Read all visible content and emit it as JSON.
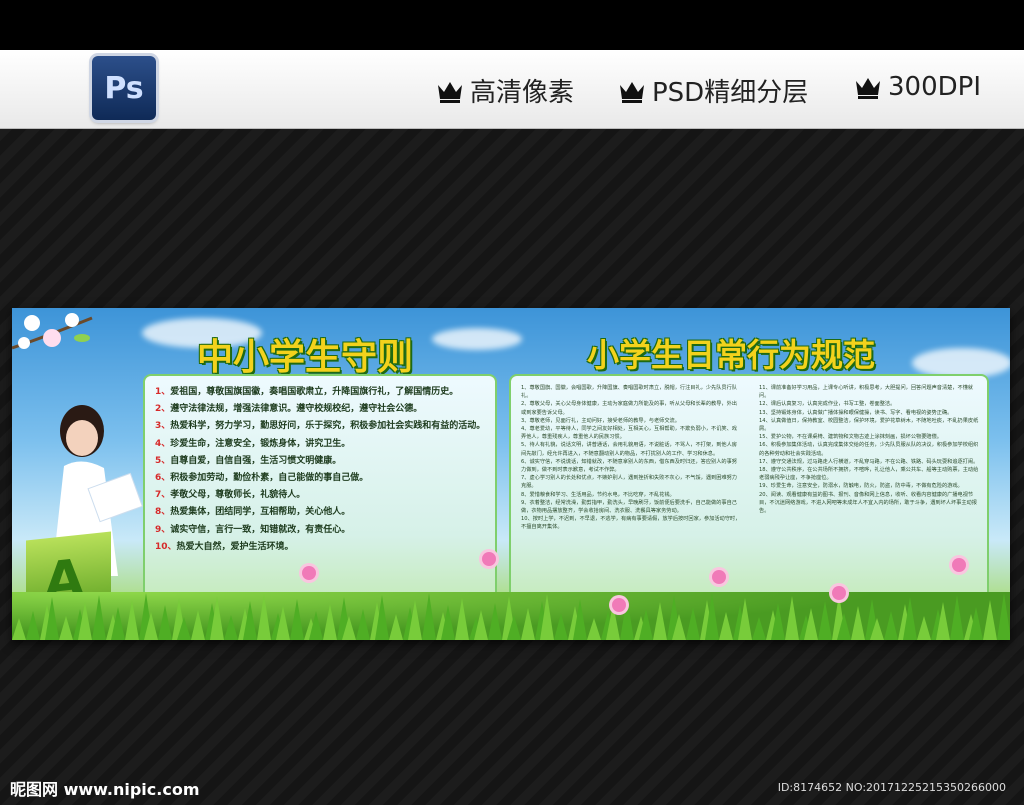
{
  "header": {
    "ps_logo": "Ps",
    "features": [
      "高清像素",
      "PSD精细分层",
      "300DPI"
    ]
  },
  "board": {
    "left_title": "中小学生守则",
    "right_title": "小学生日常行为规范",
    "left_rules": [
      {
        "num": "1、",
        "text": "爱祖国，尊敬国旗国徽，奏唱国歌肃立，升降国旗行礼，了解国情历史。"
      },
      {
        "num": "2、",
        "text": "遵守法律法规，增强法律意识。遵守校规校纪，遵守社会公德。"
      },
      {
        "num": "3、",
        "text": "热爱科学，努力学习，勤思好问，乐于探究，积极参加社会实践和有益的活动。"
      },
      {
        "num": "4、",
        "text": "珍爱生命，注意安全，锻炼身体，讲究卫生。"
      },
      {
        "num": "5、",
        "text": "自尊自爱，自信自强，生活习惯文明健康。"
      },
      {
        "num": "6、",
        "text": "积极参加劳动，勤俭朴素，自己能做的事自己做。"
      },
      {
        "num": "7、",
        "text": "孝敬父母，尊敬师长，礼貌待人。"
      },
      {
        "num": "8、",
        "text": "热爱集体，团结同学，互相帮助，关心他人。"
      },
      {
        "num": "9、",
        "text": "诚实守信，言行一致，知错就改，有责任心。"
      },
      {
        "num": "10、",
        "text": "热爱大自然，爱护生活环境。"
      }
    ],
    "right_col1": [
      "1、尊敬国旗、国徽，会唱国歌，升降国旗、奏唱国歌时肃立，脱帽，行注目礼，少先队员行队礼。",
      "2、尊敬父母，关心父母身体健康，主动为家庭做力所能及的事，听从父母和长辈的教导，外出或到家要告诉父母。",
      "3、尊敬老师，见面行礼，主动问好，接受老师的教导，与老师交流。",
      "4、尊老爱幼，平等待人，同学之间友好相处，互相关心，互相帮助，不欺负弱小，不讥笑、戏弄他人，尊重残疾人，尊重他人的民族习惯。",
      "5、待人有礼貌，说话文明，讲普通话，会用礼貌用语，不说脏话，不骂人，不打架，到他人房间先敲门，经允许再进入，不随意翻动别人的物品，不打扰别人的工作、学习和休息。",
      "6、诚实守信，不说谎话，知错就改，不随意拿别人的东西，借东西及时归还，答应别人的事努力做到，做不到时表示歉意，考试不作弊。",
      "7、虚心学习别人的长处和优点，不嫉妒别人，遇到挫折和失败不灰心，不气馁，遇到困难努力克服。",
      "8、爱惜粮食和学习、生活用品，节约水电，不比吃穿，不乱花钱。",
      "9、衣着整洁，经常洗澡，勤剪指甲，勤洗头，早晚刷牙，饭前便后要洗手，自己能做的事自己做，衣物用品摆放整齐，学会收拾房间、洗衣服、洗餐具等家务劳动。",
      "10、按时上学，不迟到，不早退，不逃学，有病有事要请假，放学后按时回家，参加活动守时，不擅自离开集体。"
    ],
    "right_col2": [
      "11、课前准备好学习用品，上课专心听讲，积极思考，大胆提问，回答问题声音清楚，不懂就问。",
      "12、课后认真复习，认真完成作业，书写工整，卷面整洁。",
      "13、坚持锻炼身体，认真做广播体操和眼保健操，读书、写字、看电视的姿势正确。",
      "14、认真做值日，保持教室、校园整洁，保护环境，爱护花草树木，不随地吐痰，不乱扔果皮纸屑。",
      "15、爱护公物，不在课桌椅、建筑物和文物古迹上涂抹刻画，损坏公物要赔偿。",
      "16、积极参加集体活动，认真完成集体交给的任务，少先队员服从队的决议，积极参加学校组织的各种劳动和社会实践活动。",
      "17、遵守交通法规，过马路走人行横道，不乱穿马路，不在公路、铁路、码头玩耍和追逐打闹。",
      "18、遵守公共秩序，在公共场所不拥挤，不喧哗，礼让他人，乘公共车、船等主动购票，主动给老弱病残孕让座，不争抢座位。",
      "19、珍爱生命，注意安全，防溺水，防触电，防火，防盗，防中毒，不做有危险的游戏。",
      "20、阅读、观看健康有益的图书、报刊、音像和网上信息，收听、收看内容健康的广播电视节目，不沉迷网络游戏，不进入网吧等未成年人不宜入内的场所，敢于斗争，遇到坏人坏事主动报告。"
    ]
  },
  "footer": {
    "site": "昵图网 www.nipic.com",
    "id": "ID:8174652 NO:20171225215350266000"
  }
}
